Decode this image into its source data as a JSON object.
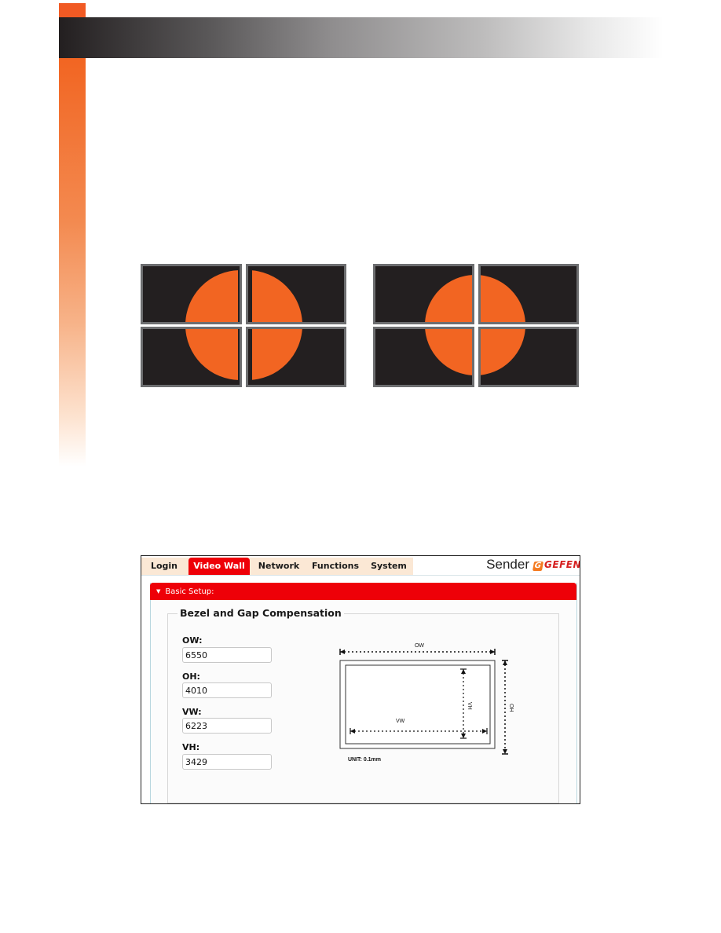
{
  "page": {
    "accent_orange": "#f26522",
    "header_dark": "#231f20"
  },
  "illustrations": {
    "left_wall": {
      "label": "video-wall-without-bezel-compensation",
      "screen_color": "#231f20",
      "bezel_color": "#6d6e70",
      "circle_color": "#f26522"
    },
    "right_wall": {
      "label": "video-wall-with-bezel-compensation",
      "screen_color": "#231f20",
      "bezel_color": "#6d6e70",
      "circle_color": "#f26522"
    }
  },
  "ui": {
    "tabs": [
      {
        "label": "Login",
        "active": false
      },
      {
        "label": "Video Wall",
        "active": true
      },
      {
        "label": "Network",
        "active": false
      },
      {
        "label": "Functions",
        "active": false
      },
      {
        "label": "System",
        "active": false
      }
    ],
    "device_label": "Sender",
    "brand": "GEFEN",
    "section_title": "Basic Setup:",
    "group_title": "Bezel and Gap Compensation",
    "fields": [
      {
        "label": "OW:",
        "value": "6550"
      },
      {
        "label": "OH:",
        "value": "4010"
      },
      {
        "label": "VW:",
        "value": "6223"
      },
      {
        "label": "VH:",
        "value": "3429"
      }
    ],
    "diagram": {
      "ow_label": "OW",
      "oh_label": "OH",
      "vw_label": "VW",
      "vh_label": "VH",
      "unit_label": "UNIT: 0.1mm"
    },
    "colors": {
      "active_tab": "#ee0008",
      "inactive_tab": "#fbe8d5"
    }
  }
}
